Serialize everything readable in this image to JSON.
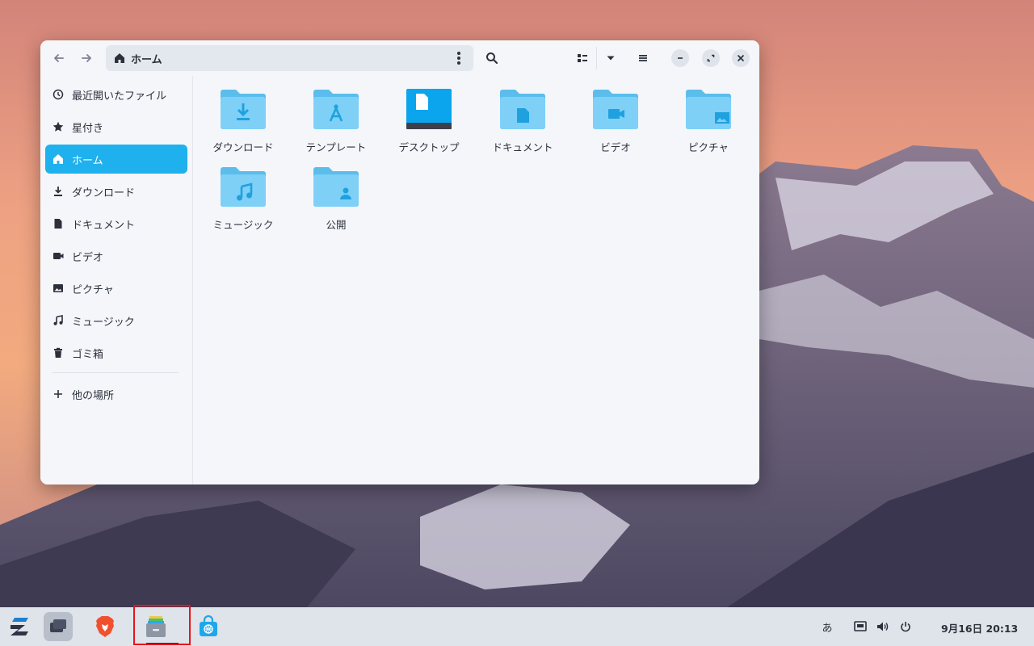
{
  "window": {
    "path": "ホーム"
  },
  "sidebar": {
    "items": [
      {
        "label": "最近開いたファイル",
        "icon": "clock-icon"
      },
      {
        "label": "星付き",
        "icon": "star-icon"
      },
      {
        "label": "ホーム",
        "icon": "home-icon",
        "active": true
      },
      {
        "label": "ダウンロード",
        "icon": "download-icon"
      },
      {
        "label": "ドキュメント",
        "icon": "document-icon"
      },
      {
        "label": "ビデオ",
        "icon": "video-icon"
      },
      {
        "label": "ピクチャ",
        "icon": "picture-icon"
      },
      {
        "label": "ミュージック",
        "icon": "music-icon"
      },
      {
        "label": "ゴミ箱",
        "icon": "trash-icon"
      }
    ],
    "other_places": "他の場所"
  },
  "folders": [
    {
      "label": "ダウンロード",
      "icon": "download-folder-icon"
    },
    {
      "label": "テンプレート",
      "icon": "templates-folder-icon"
    },
    {
      "label": "デスクトップ",
      "icon": "desktop-folder-icon"
    },
    {
      "label": "ドキュメント",
      "icon": "documents-folder-icon"
    },
    {
      "label": "ビデオ",
      "icon": "videos-folder-icon"
    },
    {
      "label": "ピクチャ",
      "icon": "pictures-folder-icon"
    },
    {
      "label": "ミュージック",
      "icon": "music-folder-icon"
    },
    {
      "label": "公開",
      "icon": "public-folder-icon"
    }
  ],
  "taskbar": {
    "input_method": "あ",
    "clock": "9月16日  20:13"
  },
  "colors": {
    "accent": "#1fb1ee",
    "folder": "#7fd0f6",
    "folder_dark": "#5bbdeb",
    "glyph": "#1fa1df",
    "highlight": "#e8141c"
  }
}
